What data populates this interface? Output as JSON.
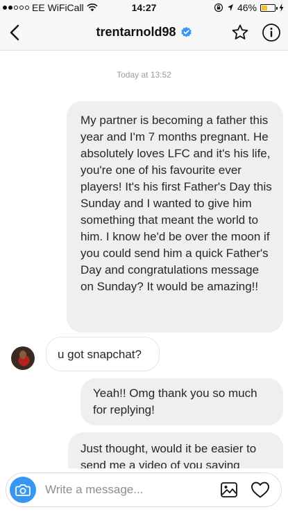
{
  "status_bar": {
    "carrier": "EE WiFiCall",
    "time": "14:27",
    "battery_percent": "46%",
    "battery_level": 0.46,
    "icons": [
      "signal-dots-icon",
      "wifi-icon",
      "screen-rotation-lock-icon",
      "location-arrow-icon",
      "battery-icon",
      "charging-icon"
    ]
  },
  "header": {
    "back_icon": "chevron-left-icon",
    "title": "trentarnold98",
    "verified_icon": "verified-badge-icon",
    "star_icon": "star-icon",
    "info_icon": "info-icon"
  },
  "chat": {
    "timestamp": "Today at 13:52",
    "messages": [
      {
        "sender": "me",
        "text": "My partner is becoming a father this year and I'm 7 months pregnant. He absolutely loves LFC and it's his life, you're one of his favourite ever players! It's his first Father's Day this Sunday and I wanted to give him something that meant the world to him. I know he'd be over the moon if you could send him a quick Father's Day and congratulations message on Sunday? It would be amazing!!"
      },
      {
        "sender": "them",
        "text": "u got snapchat?"
      },
      {
        "sender": "me",
        "text": "Yeah!! Omg thank you so much for replying!"
      },
      {
        "sender": "me",
        "text": "Just thought, would it be easier to send me a video of you saying"
      }
    ]
  },
  "composer": {
    "placeholder": "Write a message...",
    "value": "",
    "camera_icon": "camera-icon",
    "gallery_icon": "image-gallery-icon",
    "heart_icon": "heart-icon"
  },
  "colors": {
    "accent": "#3897f0",
    "verified": "#3897f0",
    "battery": "#f3c02b",
    "bubble": "#efefef",
    "timestamp": "#9a9a9a"
  }
}
